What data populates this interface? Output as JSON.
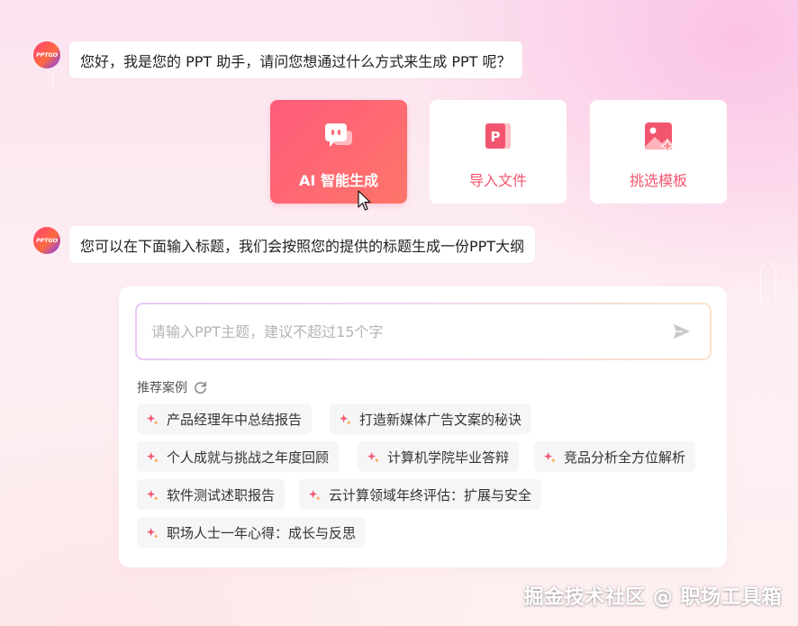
{
  "brand": {
    "avatar_text": "PPTGO"
  },
  "messages": [
    {
      "text": "您好，我是您的 PPT 助手，请问您想通过什么方式来生成 PPT 呢？"
    },
    {
      "text": "您可以在下面输入标题，我们会按照您的提供的标题生成一份PPT大纲"
    }
  ],
  "options": [
    {
      "label": "AI 智能生成",
      "icon": "chat-bubble-icon",
      "active": true
    },
    {
      "label": "导入文件",
      "icon": "ppt-file-icon",
      "active": false
    },
    {
      "label": "挑选模板",
      "icon": "image-template-icon",
      "active": false
    }
  ],
  "input": {
    "placeholder": "请输入PPT主题，建议不超过15个字",
    "value": ""
  },
  "recommend": {
    "title": "推荐案例",
    "items": [
      "产品经理年中总结报告",
      "打造新媒体广告文案的秘诀",
      "个人成就与挑战之年度回顾",
      "计算机学院毕业答辩",
      "竞品分析全方位解析",
      "软件测试述职报告",
      "云计算领域年终评估：扩展与安全",
      "职场人士一年心得：成长与反思"
    ]
  },
  "watermark": "掘金技术社区 @ 职场工具箱",
  "colors": {
    "accent": "#f2566f",
    "accent_gradient_start": "#ff5b7b",
    "accent_gradient_end": "#fd7569"
  }
}
